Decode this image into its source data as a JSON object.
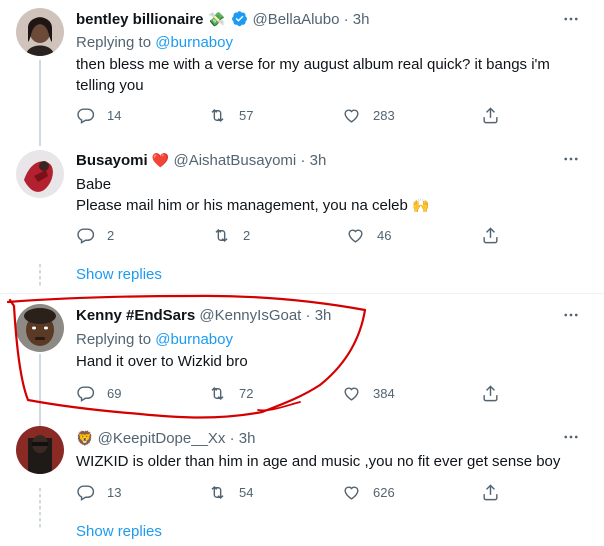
{
  "tweets": [
    {
      "name": "bentley billionaire",
      "name_emoji": "💸",
      "verified": true,
      "handle": "@BellaAlubo",
      "sep": "·",
      "time": "3h",
      "replying_prefix": "Replying to",
      "replying_to": "@burnaboy",
      "text": "then bless me with a verse for my august album real quick? it bangs i'm telling you",
      "replies": "14",
      "retweets": "57",
      "likes": "283"
    },
    {
      "name": "Busayomi",
      "name_emoji": "❤️",
      "handle": "@AishatBusayomi",
      "sep": "·",
      "time": "3h",
      "text_line1": "Babe",
      "text_line2": "Please mail him or his management, you na celeb",
      "text_emoji": "🙌",
      "replies": "2",
      "retweets": "2",
      "likes": "46"
    },
    {
      "name": "Kenny #EndSars",
      "handle": "@KennyIsGoat",
      "sep": "·",
      "time": "3h",
      "replying_prefix": "Replying to",
      "replying_to": "@burnaboy",
      "text": "Hand it over to Wizkid bro",
      "replies": "69",
      "retweets": "72",
      "likes": "384"
    },
    {
      "name_emoji": "🦁",
      "handle": "@KeepitDope__Xx",
      "sep": "·",
      "time": "3h",
      "text": "WIZKID is older than him in age and music ,you no fit ever get sense boy",
      "replies": "13",
      "retweets": "54",
      "likes": "626"
    }
  ],
  "show_replies_1": "Show replies",
  "show_replies_2": "Show replies",
  "colors": {
    "link": "#1d9bf0",
    "secondary_text": "#536471",
    "annotation_red": "#d40000",
    "verified": "#1d9bf0"
  },
  "icons": [
    "reply-icon",
    "retweet-icon",
    "like-icon",
    "share-icon",
    "more-icon",
    "verified-badge-icon"
  ]
}
